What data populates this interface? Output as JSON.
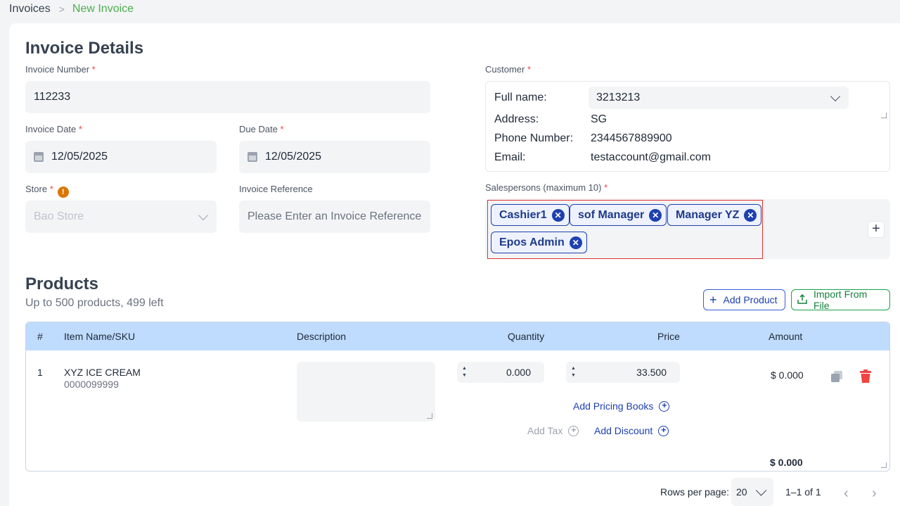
{
  "breadcrumb": {
    "parent": "Invoices",
    "separator": ">",
    "current": "New Invoice"
  },
  "invoice_details": {
    "title": "Invoice Details",
    "invoice_number": {
      "label": "Invoice Number",
      "value": "112233"
    },
    "invoice_date": {
      "label": "Invoice Date",
      "value": "12/05/2025"
    },
    "due_date": {
      "label": "Due Date",
      "value": "12/05/2025"
    },
    "store": {
      "label": "Store",
      "value": "Bao Store",
      "info_icon": "info-icon"
    },
    "invoice_reference": {
      "label": "Invoice Reference",
      "placeholder": "Please Enter an Invoice Reference"
    }
  },
  "customer": {
    "label": "Customer",
    "full_name_label": "Full name:",
    "full_name": "3213213",
    "address_label": "Address:",
    "address": "SG",
    "phone_label": "Phone Number:",
    "phone": "2344567889900",
    "email_label": "Email:",
    "email": "testaccount@gmail.com"
  },
  "salespersons": {
    "label": "Salespersons (maximum 10)",
    "chips": [
      "Cashier1",
      "sof Manager",
      "Manager YZ",
      "Epos Admin"
    ],
    "add_label": "+"
  },
  "products": {
    "title": "Products",
    "subtitle": "Up to 500 products, 499 left",
    "add_product": "Add Product",
    "import_from_file": "Import From File",
    "columns": {
      "index": "#",
      "item": "Item Name/SKU",
      "description": "Description",
      "quantity": "Quantity",
      "price": "Price",
      "amount": "Amount"
    },
    "rows": [
      {
        "index": "1",
        "name": "XYZ ICE CREAM",
        "sku": "0000099999",
        "quantity": "0.000",
        "price": "33.500",
        "amount": "$ 0.000",
        "add_pricing_books": "Add Pricing Books",
        "add_tax": "Add Tax",
        "add_discount": "Add Discount"
      }
    ],
    "total": "$ 0.000"
  },
  "pagination": {
    "rows_per_page_label": "Rows per page:",
    "rows_per_page": "20",
    "range": "1–1 of 1"
  },
  "colors": {
    "accent": "#4caf50",
    "primary": "#1e40af",
    "danger": "#ef4444",
    "highlight": "#e03131",
    "table_header": "#bfdbfe"
  }
}
